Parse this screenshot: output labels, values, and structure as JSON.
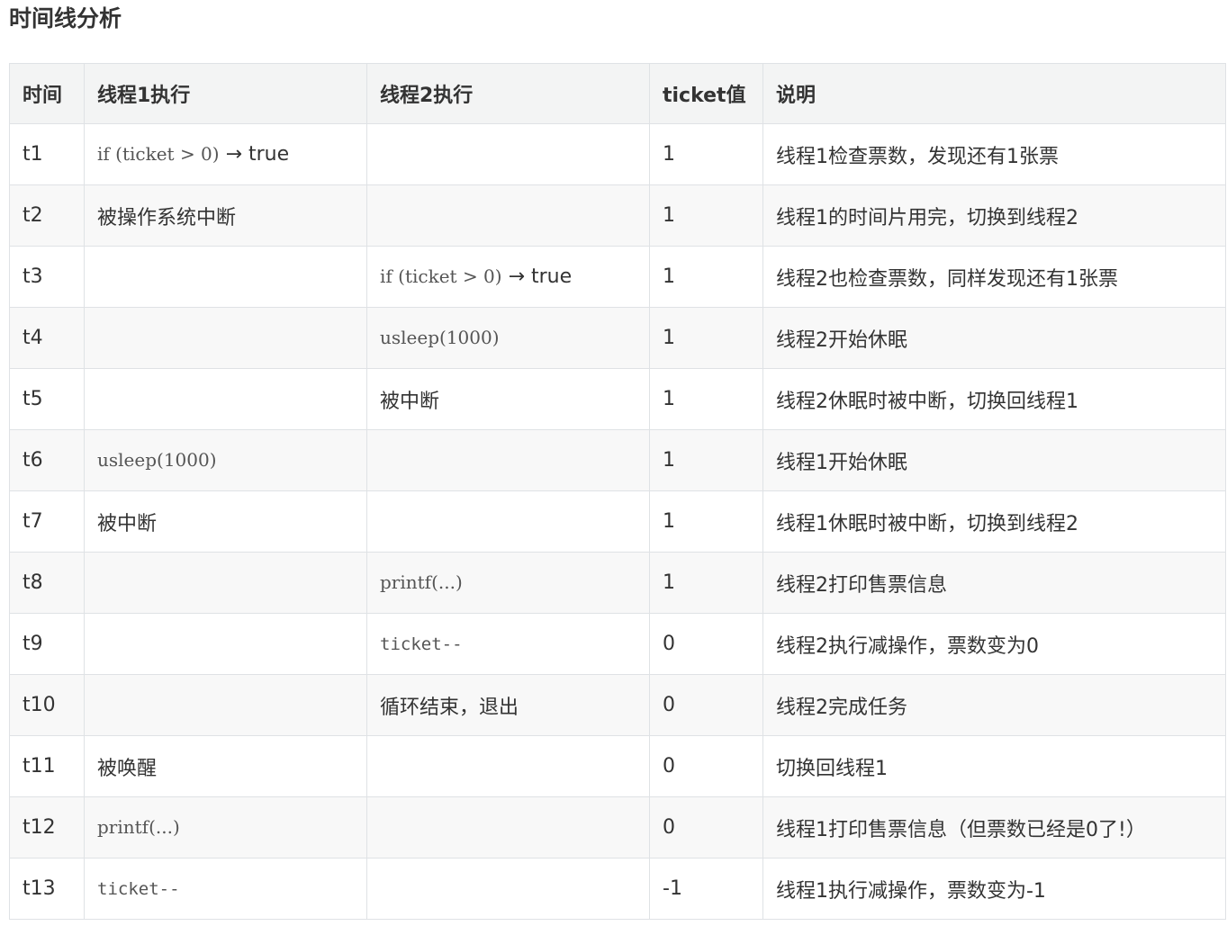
{
  "title": "时间线分析",
  "table": {
    "headers": [
      "时间",
      "线程1执行",
      "线程2执行",
      "ticket值",
      "说明"
    ],
    "rows": [
      {
        "time": "t1",
        "thread1": "if (ticket > 0) → true",
        "thread1_code": "if (ticket > 0)",
        "thread1_suffix": " → true",
        "thread2": "",
        "ticket": "1",
        "note": "线程1检查票数，发现还有1张票"
      },
      {
        "time": "t2",
        "thread1": "被操作系统中断",
        "thread2": "",
        "ticket": "1",
        "note": "线程1的时间片用完，切换到线程2"
      },
      {
        "time": "t3",
        "thread1": "",
        "thread2": "if (ticket > 0) → true",
        "thread2_code": "if (ticket > 0)",
        "thread2_suffix": " → true",
        "ticket": "1",
        "note": "线程2也检查票数，同样发现还有1张票"
      },
      {
        "time": "t4",
        "thread1": "",
        "thread2": "usleep(1000)",
        "ticket": "1",
        "note": "线程2开始休眠"
      },
      {
        "time": "t5",
        "thread1": "",
        "thread2": "被中断",
        "ticket": "1",
        "note": "线程2休眠时被中断，切换回线程1"
      },
      {
        "time": "t6",
        "thread1": "usleep(1000)",
        "thread2": "",
        "ticket": "1",
        "note": "线程1开始休眠"
      },
      {
        "time": "t7",
        "thread1": "被中断",
        "thread2": "",
        "ticket": "1",
        "note": "线程1休眠时被中断，切换到线程2"
      },
      {
        "time": "t8",
        "thread1": "",
        "thread2": "printf(...)",
        "ticket": "1",
        "note": "线程2打印售票信息"
      },
      {
        "time": "t9",
        "thread1": "",
        "thread2": "ticket--",
        "ticket": "0",
        "note": "线程2执行减操作，票数变为0"
      },
      {
        "time": "t10",
        "thread1": "",
        "thread2": "循环结束，退出",
        "ticket": "0",
        "note": "线程2完成任务"
      },
      {
        "time": "t11",
        "thread1": "被唤醒",
        "thread2": "",
        "ticket": "0",
        "note": "切换回线程1"
      },
      {
        "time": "t12",
        "thread1": "printf(...)",
        "thread2": "",
        "ticket": "0",
        "note": "线程1打印售票信息（但票数已经是0了!）"
      },
      {
        "time": "t13",
        "thread1": "ticket--",
        "thread2": "",
        "ticket": "-1",
        "note": "线程1执行减操作，票数变为-1"
      }
    ]
  }
}
